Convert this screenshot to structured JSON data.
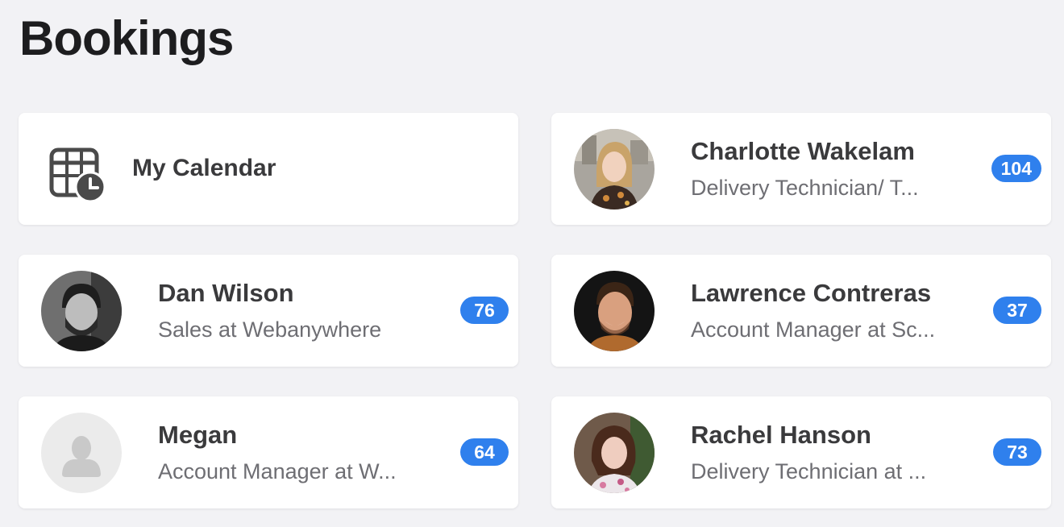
{
  "page": {
    "title": "Bookings"
  },
  "calendar": {
    "label": "My Calendar",
    "icon": "calendar-clock-icon"
  },
  "people": [
    {
      "name": "Charlotte Wakelam",
      "role": "Delivery Technician/ T...",
      "count": "104"
    },
    {
      "name": "Dan Wilson",
      "role": "Sales at Webanywhere",
      "count": "76"
    },
    {
      "name": "Lawrence Contreras",
      "role": "Account Manager at Sc...",
      "count": "37"
    },
    {
      "name": "Megan",
      "role": "Account Manager at W...",
      "count": "64"
    },
    {
      "name": "Rachel Hanson",
      "role": "Delivery Technician at ...",
      "count": "73"
    }
  ],
  "colors": {
    "badge": "#2f80ed",
    "background": "#f2f2f5",
    "card": "#ffffff"
  }
}
